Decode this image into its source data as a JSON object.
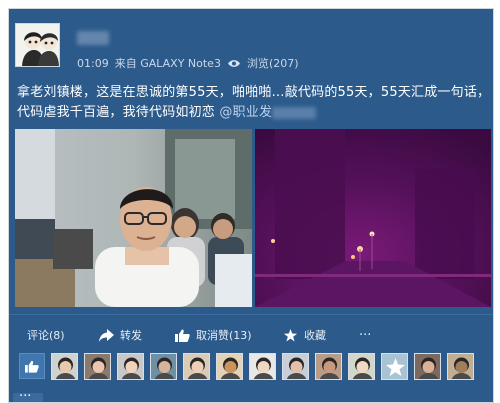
{
  "post": {
    "time": "01:09",
    "source": "来自 GALAXY Note3",
    "views": "浏览(207)",
    "text_main": "拿老刘镇楼，这是在思诚的第55天，啪啪啪…敲代码的55天，55天汇成一句话，代码虐我千百遍，我待代码如初恋",
    "mention": "@职业发"
  },
  "actions": {
    "comment": "评论(8)",
    "forward": "转发",
    "unlike": "取消赞(13)",
    "favorite": "收藏",
    "more": "···"
  },
  "likers": [
    {
      "bg": "#cfd3cf",
      "skin": "#e8c9a9"
    },
    {
      "bg": "#8b7a6c",
      "skin": "#e9c6ad"
    },
    {
      "bg": "#c8c8c8",
      "skin": "#f0d2bb"
    },
    {
      "bg": "#6f8fa5",
      "skin": "#d6b49b"
    },
    {
      "bg": "#d9cbb6",
      "skin": "#ecd0b7"
    },
    {
      "bg": "#e3d2b6",
      "skin": "#c8955c"
    },
    {
      "bg": "#e8e8e8",
      "skin": "#f1d7c2"
    },
    {
      "bg": "#c9cfd9",
      "skin": "#e2c0ac"
    },
    {
      "bg": "#b99c86",
      "skin": "#c79a7e"
    },
    {
      "bg": "#d2d7c9",
      "skin": "#efd9c3"
    },
    {
      "bg": "#a9c3d2",
      "skin": "#ffffff"
    },
    {
      "bg": "#7d6a5e",
      "skin": "#d9b298"
    },
    {
      "bg": "#bfae93",
      "skin": "#9e7e5c"
    }
  ],
  "more_bottom": "···",
  "colors": {
    "card_bg": "#2c5a8a",
    "text": "#ffffff",
    "meta": "#c9d8e8",
    "night_photo": "#5a1260"
  }
}
